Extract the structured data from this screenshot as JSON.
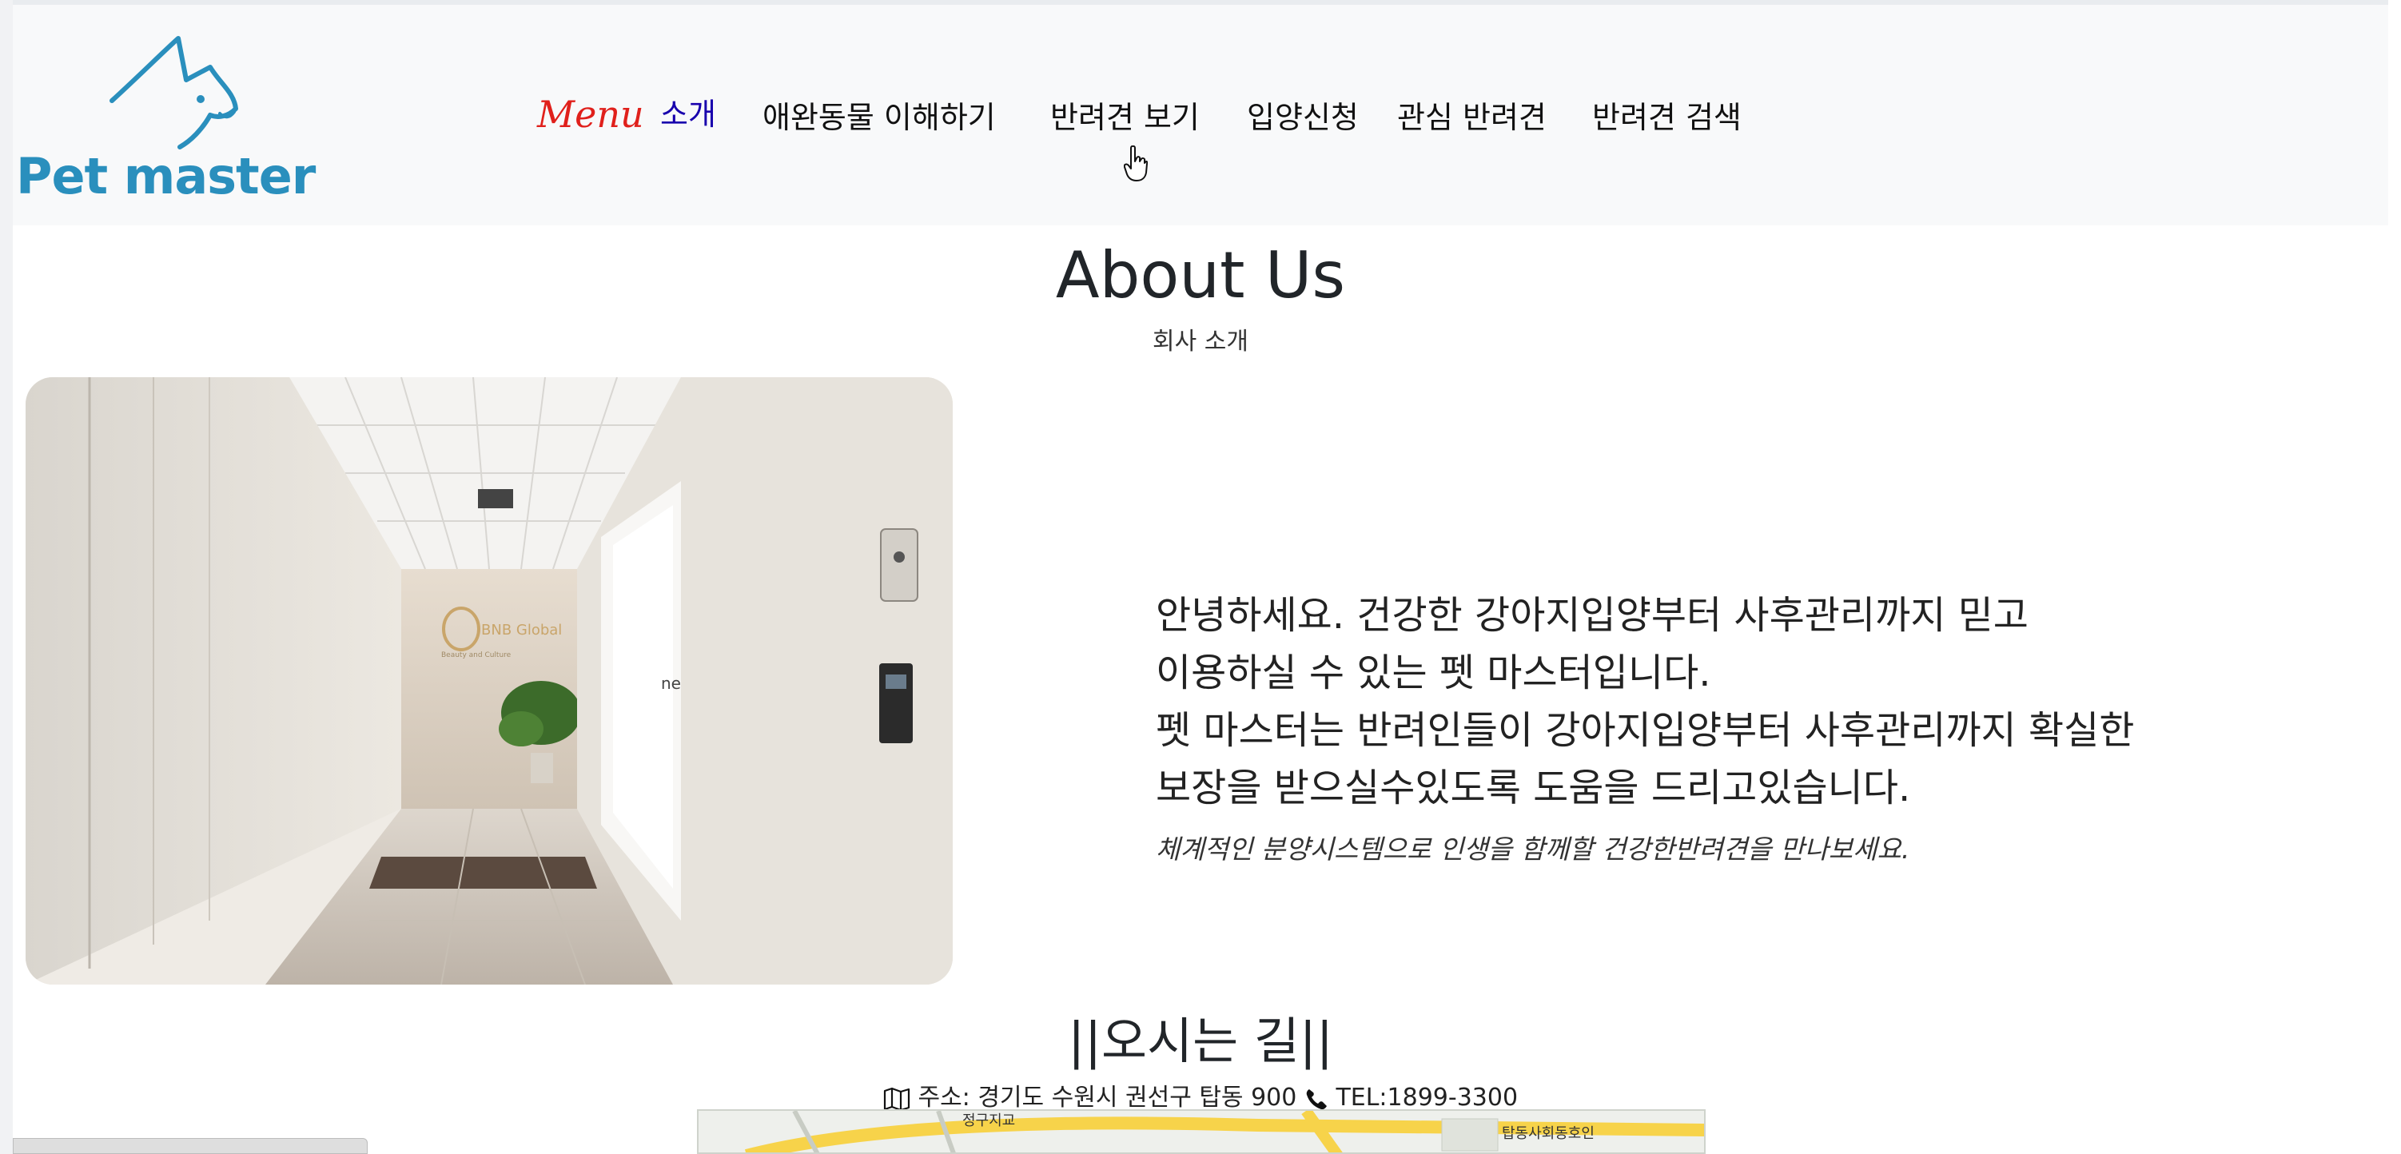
{
  "brand": {
    "name": "Pet master",
    "color": "#2a8fbd"
  },
  "nav": {
    "menu_label": "Menu",
    "links": [
      "소개",
      "애완동물 이해하기",
      "반려견 보기",
      "입양신청",
      "관심 반려견",
      "반려견 검색"
    ],
    "active_index": 0,
    "active_color": "#1800ad",
    "menu_color": "#e0201b"
  },
  "about": {
    "title": "About Us",
    "subtitle": "회사 소개",
    "paragraph_lines": [
      "안녕하세요. 건강한 강아지입양부터 사후관리까지 믿고",
      "이용하실 수 있는 펫 마스터입니다.",
      "펫 마스터는 반려인들이 강아지입양부터 사후관리까지 확실한",
      "보장을 받으실수있도록 도움을 드리고있습니다."
    ],
    "tagline": "체계적인 분양시스템으로 인생을 함께할 건강한반려견을 만나보세요.",
    "photo_sign": "BNB Global",
    "photo_sign_sub": "Beauty and Culture"
  },
  "location": {
    "title": "||오시는 길||",
    "address": "주소: 경기도 수원시 권선구 탑동 900",
    "tel": "TEL:1899-3300",
    "map_labels": [
      "정구지교",
      "탑동사회동호인"
    ]
  }
}
